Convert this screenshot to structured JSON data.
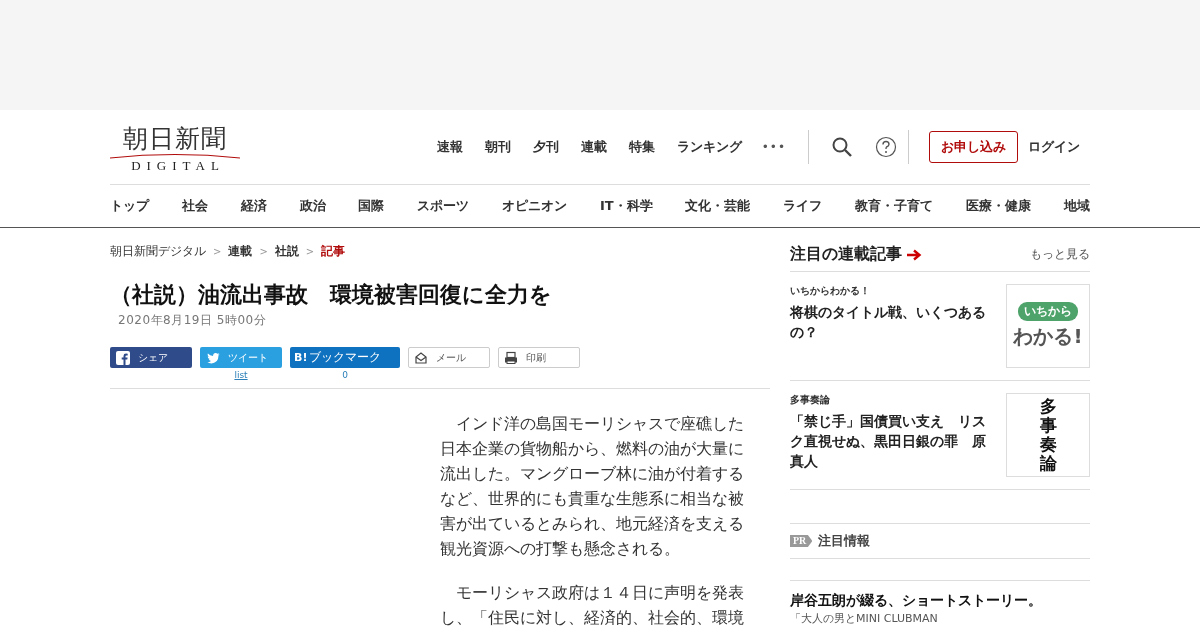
{
  "header": {
    "logo": {
      "name": "朝日新聞",
      "sub": "DIGITAL"
    },
    "top_nav": [
      "速報",
      "朝刊",
      "夕刊",
      "連載",
      "特集",
      "ランキング"
    ],
    "more": "•••",
    "subscribe": "お申し込み",
    "login": "ログイン"
  },
  "categories": [
    "トップ",
    "社会",
    "経済",
    "政治",
    "国際",
    "スポーツ",
    "オピニオン",
    "IT・科学",
    "文化・芸能",
    "ライフ",
    "教育・子育て",
    "医療・健康",
    "地域"
  ],
  "breadcrumb": {
    "separator": ">",
    "items": [
      {
        "label": "朝日新聞デジタル",
        "kind": "plain",
        "current": false
      },
      {
        "label": "連載",
        "kind": "bold",
        "current": false
      },
      {
        "label": "社説",
        "kind": "bold",
        "current": false
      },
      {
        "label": "記事",
        "kind": "bold",
        "current": true
      }
    ]
  },
  "article": {
    "title": "（社説）油流出事故　環境被害回復に全力を",
    "date": "2020年8月19日 5時00分",
    "share": [
      {
        "kind": "facebook",
        "label": "シェア"
      },
      {
        "kind": "twitter",
        "label": "ツイート",
        "count": "list"
      },
      {
        "kind": "hatena",
        "label": "ブックマーク",
        "icon_text": "B!",
        "count": "0"
      },
      {
        "kind": "mail",
        "label": "メール"
      },
      {
        "kind": "print",
        "label": "印刷"
      }
    ],
    "paragraphs": [
      "　インド洋の島国モーリシャスで座礁した日本企業の貨物船から、燃料の油が大量に流出した。マングローブ林に油が付着するなど、世界的にも貴重な生態系に相当な被害が出ているとみられ、地元経済を支える観光資源への打撃も懸念される。",
      "　モーリシャス政府は１４日に声明を発表し、「住民に対し、経済的、社会的、環境"
    ]
  },
  "sidebar": {
    "heading": "注目の連載記事",
    "more": "もっと見る",
    "items": [
      {
        "series": "いちからわかる！",
        "title": "将棋のタイトル戦、いくつあるの？",
        "thumb": {
          "kind": "ichikara",
          "lines": [
            "いちから",
            "わかる!"
          ]
        }
      },
      {
        "series": "多事奏論",
        "title": "「禁じ手」国債買い支え　リスク直視せぬ、黒田日銀の罪　原真人",
        "thumb": {
          "kind": "calligraphy",
          "lines": [
            "多",
            "事",
            "奏",
            "論"
          ]
        }
      }
    ],
    "pr": {
      "badge": "PR",
      "label": "注目情報"
    },
    "promo": {
      "title": "岸谷五朗が綴る、ショートストーリー。",
      "subtitle": "「大人の男とMINI CLUBMAN"
    }
  }
}
